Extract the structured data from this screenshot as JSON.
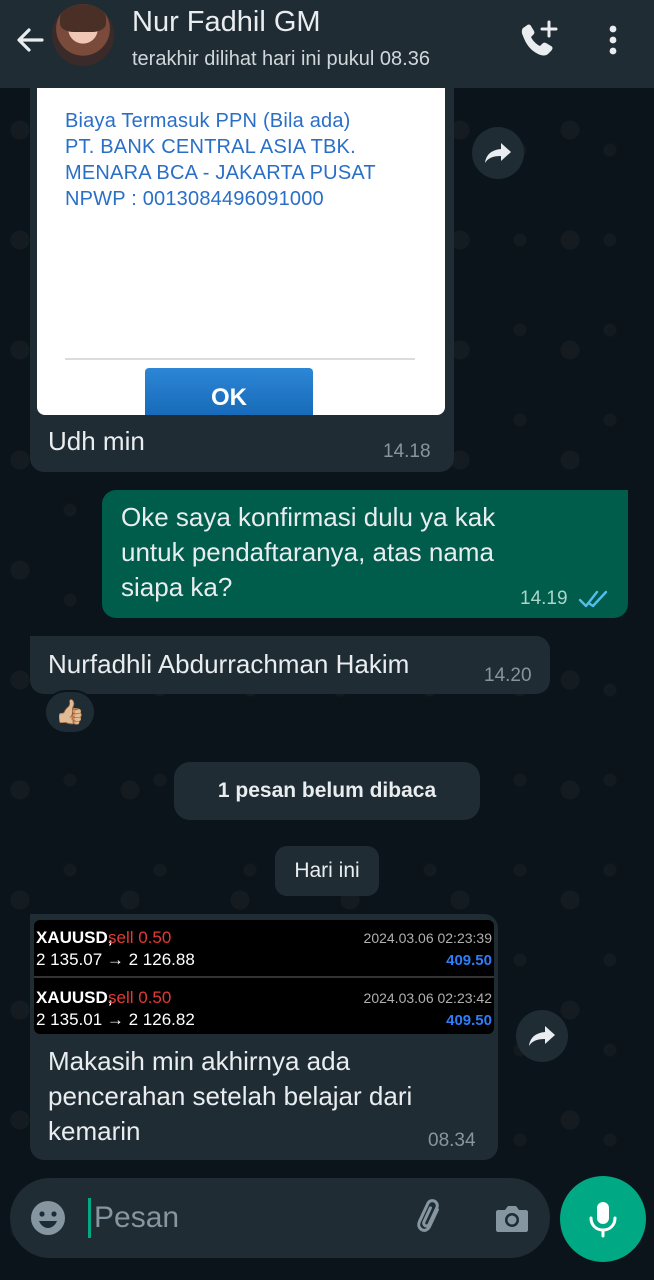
{
  "header": {
    "contact_name": "Nur Fadhil GM",
    "last_seen": "terakhir dilihat hari ini pukul 08.36"
  },
  "messages": {
    "m1": {
      "receipt_lines": [
        "Biaya Termasuk PPN (Bila ada)",
        "PT. BANK CENTRAL ASIA TBK.",
        "MENARA BCA - JAKARTA PUSAT",
        "NPWP : 0013084496091000"
      ],
      "ok_label": "OK",
      "caption": "Udh min",
      "time": "14.18"
    },
    "m2": {
      "lines": [
        "Oke saya konfirmasi dulu ya kak",
        "untuk pendaftaranya, atas nama",
        "siapa ka?"
      ],
      "time": "14.19",
      "status": "read"
    },
    "m3": {
      "text": "Nurfadhli Abdurrachman Hakim",
      "time": "14.20",
      "reaction": "👍🏼"
    },
    "unread_banner": "1 pesan belum dibaca",
    "date_divider": "Hari ini",
    "m4": {
      "trades": [
        {
          "symbol": "XAUUSD,",
          "side": "sell 0.50",
          "prices": "2 135.07 → 2 126.88",
          "datetime": "2024.03.06 02:23:39",
          "profit": "409.50"
        },
        {
          "symbol": "XAUUSD,",
          "side": "sell 0.50",
          "prices": "2 135.01 → 2 126.82",
          "datetime": "2024.03.06 02:23:42",
          "profit": "409.50"
        }
      ],
      "lines": [
        "Makasih min akhirnya ada",
        "pencerahan setelah belajar dari",
        "kemarin"
      ],
      "time": "08.34"
    }
  },
  "composer": {
    "placeholder": "Pesan"
  },
  "colors": {
    "header_bg": "#1f2c34",
    "chat_bg": "#0b141a",
    "bubble_in": "#1f2c34",
    "bubble_out": "#005c4b",
    "accent": "#00a884",
    "read_ticks": "#53bdeb"
  },
  "icons": {
    "back": "arrow-left-icon",
    "add_call": "phone-plus-icon",
    "menu": "more-vertical-icon",
    "forward": "forward-icon",
    "emoji": "emoji-icon",
    "attach": "paperclip-icon",
    "camera": "camera-icon",
    "mic": "mic-icon"
  }
}
